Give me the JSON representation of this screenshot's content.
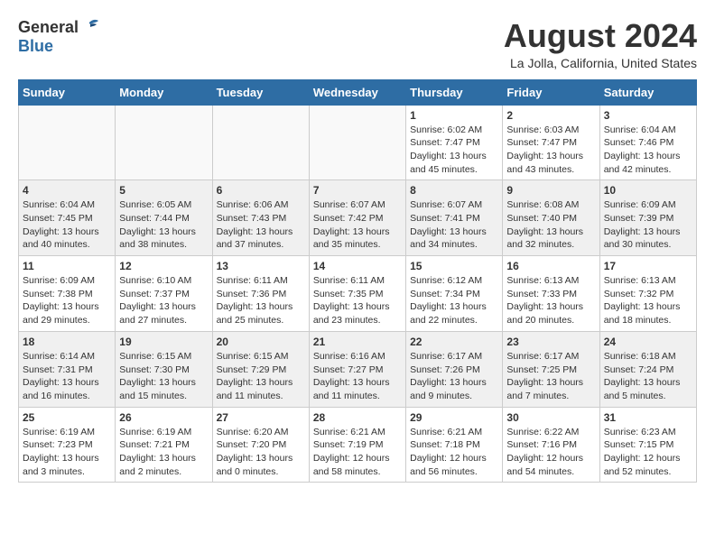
{
  "header": {
    "logo_general": "General",
    "logo_blue": "Blue",
    "title": "August 2024",
    "subtitle": "La Jolla, California, United States"
  },
  "weekdays": [
    "Sunday",
    "Monday",
    "Tuesday",
    "Wednesday",
    "Thursday",
    "Friday",
    "Saturday"
  ],
  "weeks": [
    [
      {
        "day": "",
        "empty": true
      },
      {
        "day": "",
        "empty": true
      },
      {
        "day": "",
        "empty": true
      },
      {
        "day": "",
        "empty": true
      },
      {
        "day": "1",
        "sunrise": "6:02 AM",
        "sunset": "7:47 PM",
        "daylight": "13 hours and 45 minutes."
      },
      {
        "day": "2",
        "sunrise": "6:03 AM",
        "sunset": "7:47 PM",
        "daylight": "13 hours and 43 minutes."
      },
      {
        "day": "3",
        "sunrise": "6:04 AM",
        "sunset": "7:46 PM",
        "daylight": "13 hours and 42 minutes."
      }
    ],
    [
      {
        "day": "4",
        "sunrise": "6:04 AM",
        "sunset": "7:45 PM",
        "daylight": "13 hours and 40 minutes."
      },
      {
        "day": "5",
        "sunrise": "6:05 AM",
        "sunset": "7:44 PM",
        "daylight": "13 hours and 38 minutes."
      },
      {
        "day": "6",
        "sunrise": "6:06 AM",
        "sunset": "7:43 PM",
        "daylight": "13 hours and 37 minutes."
      },
      {
        "day": "7",
        "sunrise": "6:07 AM",
        "sunset": "7:42 PM",
        "daylight": "13 hours and 35 minutes."
      },
      {
        "day": "8",
        "sunrise": "6:07 AM",
        "sunset": "7:41 PM",
        "daylight": "13 hours and 34 minutes."
      },
      {
        "day": "9",
        "sunrise": "6:08 AM",
        "sunset": "7:40 PM",
        "daylight": "13 hours and 32 minutes."
      },
      {
        "day": "10",
        "sunrise": "6:09 AM",
        "sunset": "7:39 PM",
        "daylight": "13 hours and 30 minutes."
      }
    ],
    [
      {
        "day": "11",
        "sunrise": "6:09 AM",
        "sunset": "7:38 PM",
        "daylight": "13 hours and 29 minutes."
      },
      {
        "day": "12",
        "sunrise": "6:10 AM",
        "sunset": "7:37 PM",
        "daylight": "13 hours and 27 minutes."
      },
      {
        "day": "13",
        "sunrise": "6:11 AM",
        "sunset": "7:36 PM",
        "daylight": "13 hours and 25 minutes."
      },
      {
        "day": "14",
        "sunrise": "6:11 AM",
        "sunset": "7:35 PM",
        "daylight": "13 hours and 23 minutes."
      },
      {
        "day": "15",
        "sunrise": "6:12 AM",
        "sunset": "7:34 PM",
        "daylight": "13 hours and 22 minutes."
      },
      {
        "day": "16",
        "sunrise": "6:13 AM",
        "sunset": "7:33 PM",
        "daylight": "13 hours and 20 minutes."
      },
      {
        "day": "17",
        "sunrise": "6:13 AM",
        "sunset": "7:32 PM",
        "daylight": "13 hours and 18 minutes."
      }
    ],
    [
      {
        "day": "18",
        "sunrise": "6:14 AM",
        "sunset": "7:31 PM",
        "daylight": "13 hours and 16 minutes."
      },
      {
        "day": "19",
        "sunrise": "6:15 AM",
        "sunset": "7:30 PM",
        "daylight": "13 hours and 15 minutes."
      },
      {
        "day": "20",
        "sunrise": "6:15 AM",
        "sunset": "7:29 PM",
        "daylight": "13 hours and 11 minutes."
      },
      {
        "day": "21",
        "sunrise": "6:16 AM",
        "sunset": "7:27 PM",
        "daylight": "13 hours and 11 minutes."
      },
      {
        "day": "22",
        "sunrise": "6:17 AM",
        "sunset": "7:26 PM",
        "daylight": "13 hours and 9 minutes."
      },
      {
        "day": "23",
        "sunrise": "6:17 AM",
        "sunset": "7:25 PM",
        "daylight": "13 hours and 7 minutes."
      },
      {
        "day": "24",
        "sunrise": "6:18 AM",
        "sunset": "7:24 PM",
        "daylight": "13 hours and 5 minutes."
      }
    ],
    [
      {
        "day": "25",
        "sunrise": "6:19 AM",
        "sunset": "7:23 PM",
        "daylight": "13 hours and 3 minutes."
      },
      {
        "day": "26",
        "sunrise": "6:19 AM",
        "sunset": "7:21 PM",
        "daylight": "13 hours and 2 minutes."
      },
      {
        "day": "27",
        "sunrise": "6:20 AM",
        "sunset": "7:20 PM",
        "daylight": "13 hours and 0 minutes."
      },
      {
        "day": "28",
        "sunrise": "6:21 AM",
        "sunset": "7:19 PM",
        "daylight": "12 hours and 58 minutes."
      },
      {
        "day": "29",
        "sunrise": "6:21 AM",
        "sunset": "7:18 PM",
        "daylight": "12 hours and 56 minutes."
      },
      {
        "day": "30",
        "sunrise": "6:22 AM",
        "sunset": "7:16 PM",
        "daylight": "12 hours and 54 minutes."
      },
      {
        "day": "31",
        "sunrise": "6:23 AM",
        "sunset": "7:15 PM",
        "daylight": "12 hours and 52 minutes."
      }
    ]
  ],
  "labels": {
    "sunrise": "Sunrise:",
    "sunset": "Sunset:",
    "daylight": "Daylight:"
  }
}
